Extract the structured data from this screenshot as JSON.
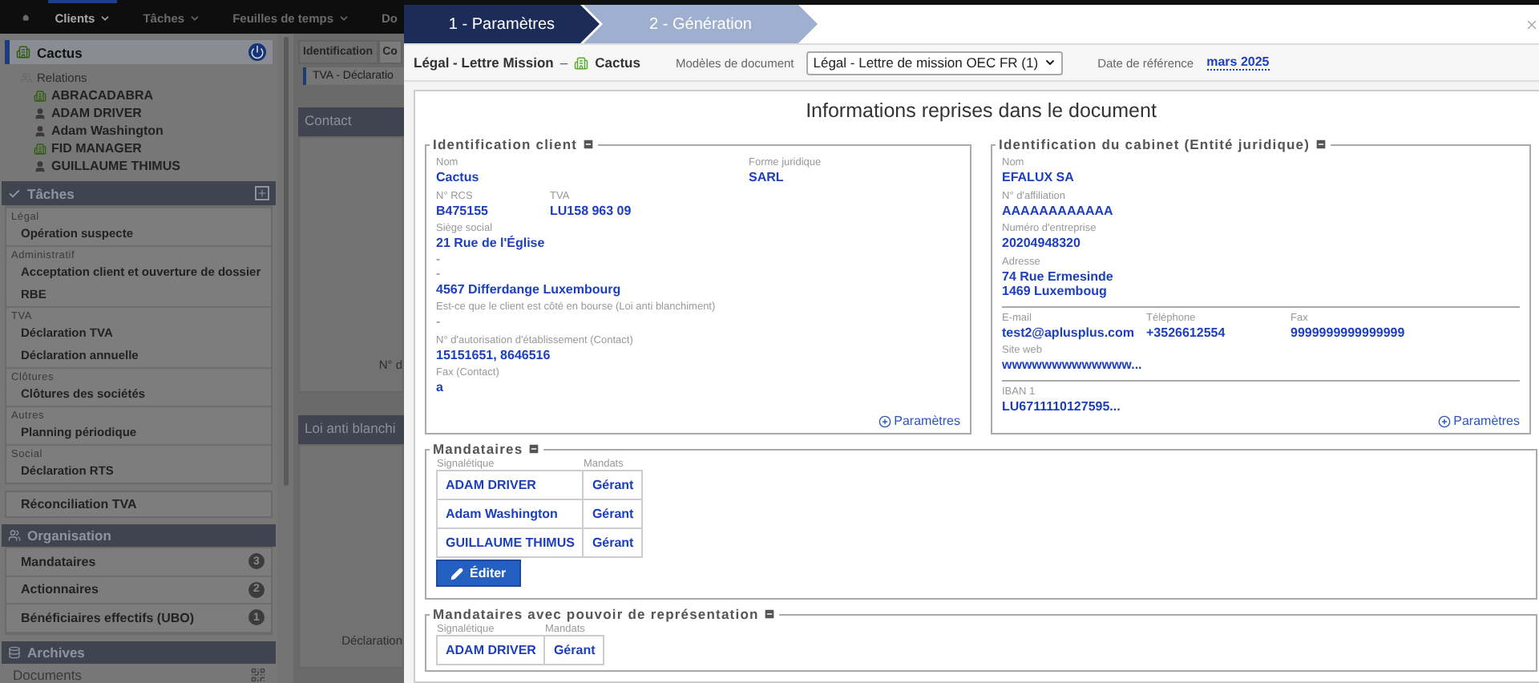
{
  "nav": {
    "items": [
      {
        "label": "Clients",
        "selected": true,
        "dropdown": true
      },
      {
        "label": "Tâches",
        "selected": false,
        "dropdown": true
      },
      {
        "label": "Feuilles de temps",
        "selected": false,
        "dropdown": true
      },
      {
        "label": "Do",
        "selected": false,
        "dropdown": false
      }
    ]
  },
  "sidebar": {
    "client": "Cactus",
    "relations_label": "Relations",
    "relations": [
      {
        "name": "ABRACADABRA",
        "kind": "company"
      },
      {
        "name": "ADAM DRIVER",
        "kind": "person"
      },
      {
        "name": "Adam Washington",
        "kind": "person"
      },
      {
        "name": "FID MANAGER",
        "kind": "company"
      },
      {
        "name": "GUILLAUME THIMUS",
        "kind": "person"
      }
    ],
    "tasks": {
      "title": "Tâches",
      "groups": [
        {
          "label": "Légal",
          "items": [
            "Opération suspecte"
          ]
        },
        {
          "label": "Administratif",
          "items": [
            "Acceptation client et ouverture de dossier",
            "RBE"
          ]
        },
        {
          "label": "TVA",
          "items": [
            "Déclaration TVA",
            "Déclaration annuelle"
          ]
        },
        {
          "label": "Clôtures",
          "items": [
            "Clôtures des sociétés"
          ]
        },
        {
          "label": "Autres",
          "items": [
            "Planning périodique"
          ]
        },
        {
          "label": "Social",
          "items": [
            "Déclaration RTS"
          ]
        }
      ]
    },
    "reconciliation": "Réconciliation TVA",
    "organisation": {
      "title": "Organisation",
      "items": [
        {
          "label": "Mandataires",
          "count": "3"
        },
        {
          "label": "Actionnaires",
          "count": "2"
        },
        {
          "label": "Bénéficiaires effectifs (UBO)",
          "count": "1"
        }
      ]
    },
    "archives": {
      "title": "Archives",
      "items": [
        "Documents"
      ]
    }
  },
  "content": {
    "tabs": [
      {
        "label": "Identification",
        "selected": false
      },
      {
        "label": "Co",
        "selected": true
      }
    ],
    "subtab": "TVA - Déclaratio",
    "panels": [
      {
        "title": "Contact",
        "field": "N° d"
      },
      {
        "title": "Loi anti blanchi",
        "field": "Déclaration"
      }
    ]
  },
  "modal": {
    "steps": [
      {
        "label": "1 - Paramètres",
        "selected": true
      },
      {
        "label": "2 - Génération",
        "selected": false
      }
    ],
    "toolbar": {
      "document": "Légal - Lettre Mission",
      "separator": "–",
      "client": "Cactus",
      "models_label": "Modèles de document",
      "model_value": "Légal - Lettre de mission OEC FR (1)",
      "date_label": "Date de référence",
      "date_value": "mars 2025"
    },
    "panel_title": "Informations reprises dans le document",
    "sections": [
      {
        "legend": "Identification client",
        "link": "Paramètres",
        "rows": [
          {
            "divider": false,
            "fields": [
              {
                "label": "Nom",
                "lines": [
                  {
                    "text": "Cactus",
                    "muted": false
                  }
                ]
              },
              {
                "label": "Forme juridique",
                "lines": [
                  {
                    "text": "SARL",
                    "muted": false
                  }
                ]
              }
            ]
          },
          {
            "divider": false,
            "fields": [
              {
                "label": "N° RCS",
                "lines": [
                  {
                    "text": "B475155",
                    "muted": false
                  }
                ]
              },
              {
                "label": "TVA",
                "lines": [
                  {
                    "text": "LU158 963 09",
                    "muted": false
                  }
                ]
              }
            ]
          },
          {
            "divider": false,
            "fields": [
              {
                "label": "Siège social",
                "lines": [
                  {
                    "text": "21 Rue de l'Église",
                    "muted": false
                  },
                  {
                    "text": "-",
                    "muted": true
                  },
                  {
                    "text": "-",
                    "muted": true
                  },
                  {
                    "text": "4567 Differdange Luxembourg",
                    "muted": false
                  }
                ]
              }
            ]
          },
          {
            "divider": false,
            "fields": [
              {
                "label": "Est-ce que le client est côté en bourse (Loi anti blanchiment)",
                "lines": [
                  {
                    "text": "-",
                    "muted": true
                  }
                ]
              }
            ]
          },
          {
            "divider": false,
            "fields": [
              {
                "label": "N° d'autorisation d'établissement (Contact)",
                "lines": [
                  {
                    "text": "15151651, 8646516",
                    "muted": false
                  }
                ]
              }
            ]
          },
          {
            "divider": false,
            "fields": [
              {
                "label": "Fax (Contact)",
                "lines": [
                  {
                    "text": "a",
                    "muted": false
                  }
                ]
              }
            ]
          }
        ]
      },
      {
        "legend": "Identification du cabinet (Entité juridique)",
        "link": "Paramètres",
        "rows": [
          {
            "divider": false,
            "fields": [
              {
                "label": "Nom",
                "lines": [
                  {
                    "text": "EFALUX SA",
                    "muted": false
                  }
                ]
              }
            ]
          },
          {
            "divider": false,
            "fields": [
              {
                "label": "N° d'affiliation",
                "lines": [
                  {
                    "text": "AAAAAAAAAAAA",
                    "muted": false
                  }
                ]
              }
            ]
          },
          {
            "divider": false,
            "fields": [
              {
                "label": "Numéro d'entreprise",
                "lines": [
                  {
                    "text": "20204948320",
                    "muted": false
                  }
                ]
              }
            ]
          },
          {
            "divider": false,
            "fields": [
              {
                "label": "Adresse",
                "lines": [
                  {
                    "text": "74 Rue Ermesinde",
                    "muted": false
                  },
                  {
                    "text": "1469 Luxemboug",
                    "muted": false
                  }
                ]
              }
            ]
          },
          {
            "divider": true,
            "fields": [
              {
                "label": "E-mail",
                "lines": [
                  {
                    "text": "test2@aplusplus.com",
                    "muted": false
                  }
                ]
              },
              {
                "label": "Téléphone",
                "lines": [
                  {
                    "text": "+3526612554",
                    "muted": false
                  }
                ]
              },
              {
                "label": "Fax",
                "lines": [
                  {
                    "text": "9999999999999999",
                    "muted": false
                  }
                ]
              }
            ]
          },
          {
            "divider": false,
            "fields": [
              {
                "label": "Site web",
                "lines": [
                  {
                    "text": "wwwwwwwwwwwww...",
                    "muted": false
                  }
                ]
              }
            ]
          },
          {
            "divider": true,
            "fields": [
              {
                "label": "IBAN 1",
                "lines": [
                  {
                    "text": "LU6711110127595...",
                    "muted": false
                  }
                ]
              }
            ]
          }
        ]
      }
    ],
    "mandate_tables": [
      {
        "legend": "Mandataires",
        "columns": [
          "Signalétique",
          "Mandats"
        ],
        "rows": [
          [
            "ADAM DRIVER",
            "Gérant"
          ],
          [
            "Adam Washington",
            "Gérant"
          ],
          [
            "GUILLAUME THIMUS",
            "Gérant"
          ]
        ],
        "button": "Éditer"
      },
      {
        "legend": "Mandataires avec pouvoir de représentation",
        "columns": [
          "Signalétique",
          "Mandats"
        ],
        "rows": [
          [
            "ADAM DRIVER",
            "Gérant"
          ]
        ]
      }
    ]
  }
}
